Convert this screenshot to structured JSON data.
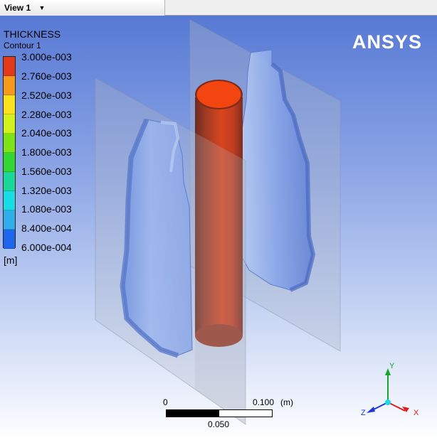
{
  "tab": {
    "label": "View 1",
    "arrow": "▼"
  },
  "legend": {
    "title": "THICKNESS",
    "subtitle": "Contour 1",
    "unit": "[m]",
    "levels": [
      {
        "label": "3.000e-003",
        "color": "#e2391a"
      },
      {
        "label": "2.760e-003",
        "color": "#f59a1c"
      },
      {
        "label": "2.520e-003",
        "color": "#fde11f"
      },
      {
        "label": "2.280e-003",
        "color": "#d1f31b"
      },
      {
        "label": "2.040e-003",
        "color": "#7fe417"
      },
      {
        "label": "1.800e-003",
        "color": "#32d733"
      },
      {
        "label": "1.560e-003",
        "color": "#1ad89a"
      },
      {
        "label": "1.320e-003",
        "color": "#18dde6"
      },
      {
        "label": "1.080e-003",
        "color": "#2faee9"
      },
      {
        "label": "8.400e-004",
        "color": "#1f66ef"
      },
      {
        "label": "6.000e-004",
        "color": ""
      }
    ]
  },
  "brand": "ANSYS",
  "scale": {
    "left_label": "0",
    "right_label": "0.100",
    "unit": "(m)",
    "mid_label": "0.050"
  },
  "axes": {
    "x": "X",
    "y": "Y",
    "z": "Z",
    "x_color": "#e11a1a",
    "y_color": "#17a52c",
    "z_color": "#1a39d8"
  },
  "colors": {
    "cylinder": "#d2431f",
    "cylinder_inside": "#f24a10",
    "bottle": "#7a9be6",
    "plane": "#9aa6c8"
  }
}
